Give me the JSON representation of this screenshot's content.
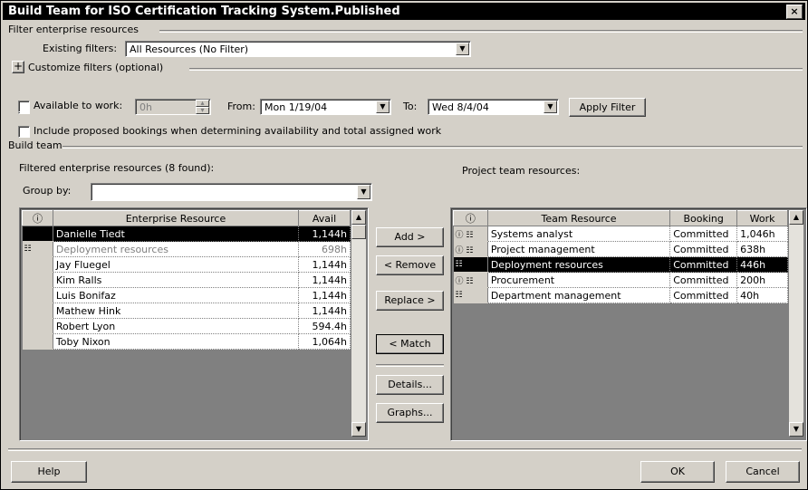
{
  "title": "Build Team for ISO Certification Tracking System.Published",
  "close_glyph": "×",
  "filter": {
    "group_label": "Filter enterprise resources",
    "existing_label": "Existing filters:",
    "existing_value": "All Resources (No Filter)",
    "customize_toggle": "+",
    "customize_label": "Customize filters (optional)"
  },
  "availability": {
    "available_label": "Available to work:",
    "hours_value": "0h",
    "from_label": "From:",
    "from_value": "Mon 1/19/04",
    "to_label": "To:",
    "to_value": "Wed 8/4/04",
    "apply_label": "Apply Filter",
    "proposed_label": "Include proposed bookings when determining availability and total assigned work"
  },
  "build": {
    "group_label": "Build team",
    "filtered_label": "Filtered enterprise resources (8 found):",
    "groupby_label": "Group by:",
    "groupby_value": "",
    "project_label": "Project team resources:"
  },
  "enterprise": {
    "headers": {
      "info": "ⓘ",
      "name": "Enterprise Resource",
      "avail": "Avail"
    },
    "rows": [
      {
        "indicator": "",
        "name": "Danielle Tiedt",
        "avail": "1,144h",
        "state": "selected"
      },
      {
        "indicator": "☷",
        "name": "Deployment resources",
        "avail": "698h",
        "state": "gray"
      },
      {
        "indicator": "",
        "name": "Jay Fluegel",
        "avail": "1,144h",
        "state": ""
      },
      {
        "indicator": "",
        "name": "Kim Ralls",
        "avail": "1,144h",
        "state": ""
      },
      {
        "indicator": "",
        "name": "Luis Bonifaz",
        "avail": "1,144h",
        "state": ""
      },
      {
        "indicator": "",
        "name": "Mathew Hink",
        "avail": "1,144h",
        "state": ""
      },
      {
        "indicator": "",
        "name": "Robert Lyon",
        "avail": "594.4h",
        "state": ""
      },
      {
        "indicator": "",
        "name": "Toby Nixon",
        "avail": "1,064h",
        "state": ""
      }
    ]
  },
  "buttons": {
    "add": "Add >",
    "remove": "< Remove",
    "replace": "Replace >",
    "match": "< Match",
    "details": "Details...",
    "graphs": "Graphs...",
    "help": "Help",
    "ok": "OK",
    "cancel": "Cancel"
  },
  "team": {
    "headers": {
      "info": "ⓘ",
      "name": "Team Resource",
      "booking": "Booking",
      "work": "Work"
    },
    "rows": [
      {
        "indicator": "ⓘ ☷",
        "name": "Systems analyst",
        "booking": "Committed",
        "work": "1,046h",
        "state": ""
      },
      {
        "indicator": "ⓘ ☷",
        "name": "Project management",
        "booking": "Committed",
        "work": "638h",
        "state": ""
      },
      {
        "indicator": "☷",
        "name": "Deployment resources",
        "booking": "Committed",
        "work": "446h",
        "state": "selected"
      },
      {
        "indicator": "ⓘ ☷",
        "name": "Procurement",
        "booking": "Committed",
        "work": "200h",
        "state": ""
      },
      {
        "indicator": "☷",
        "name": "Department management",
        "booking": "Committed",
        "work": "40h",
        "state": ""
      }
    ]
  },
  "scroll": {
    "up": "▲",
    "down": "▼",
    "dropdown": "▼",
    "spin_up": "▴",
    "spin_down": "▾"
  }
}
